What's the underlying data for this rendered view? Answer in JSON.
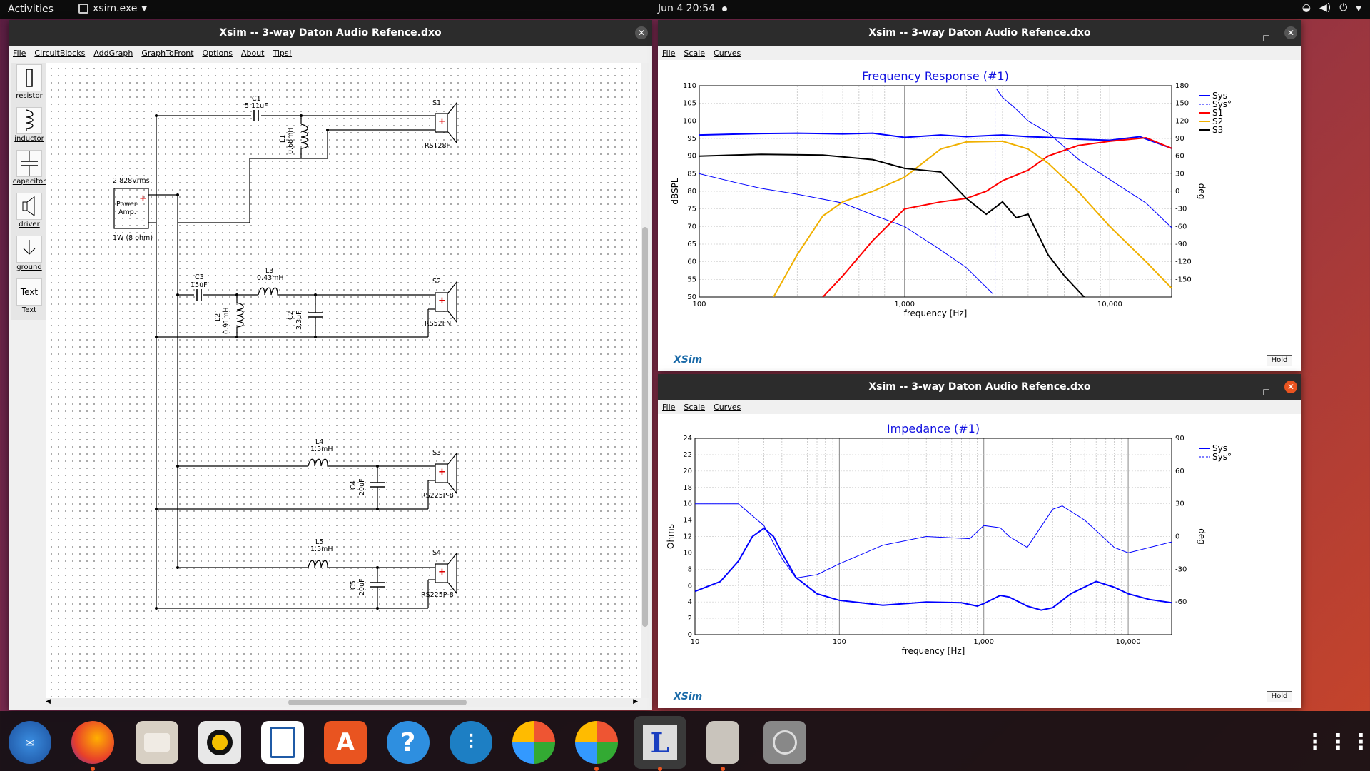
{
  "topbar": {
    "activities": "Activities",
    "app_name": "xsim.exe",
    "clock": "Jun 4  20:54"
  },
  "main_window": {
    "title": "Xsim -- 3-way Daton Audio Refence.dxo",
    "menu": [
      "File",
      "CircuitBlocks",
      "AddGraph",
      "GraphToFront",
      "Options",
      "About",
      "Tips!"
    ],
    "palette": [
      "resistor",
      "inductor",
      "capacitor",
      "driver",
      "ground",
      "Text"
    ],
    "text_tool_glyph": "Text"
  },
  "schematic": {
    "source_voltage": "2.828Vrms",
    "source_name_1": "Power",
    "source_name_2": "Amp.",
    "source_load": "1W (8 ohm)",
    "components": {
      "C1": {
        "name": "C1",
        "value": "5.11uF"
      },
      "L1": {
        "name": "L1",
        "value": "0.68mH"
      },
      "S1": {
        "name": "S1",
        "model": "RST28F"
      },
      "C3": {
        "name": "C3",
        "value": "15uF"
      },
      "L3": {
        "name": "L3",
        "value": "0.43mH"
      },
      "L2": {
        "name": "L2",
        "value": "0.91mH"
      },
      "C2": {
        "name": "C2",
        "value": "3.3uF"
      },
      "S2": {
        "name": "S2",
        "model": "RS52FN"
      },
      "L4": {
        "name": "L4",
        "value": "1.5mH"
      },
      "C4": {
        "name": "C4",
        "value": "20uF"
      },
      "S3": {
        "name": "S3",
        "model": "RS225P-8"
      },
      "L5": {
        "name": "L5",
        "value": "1.5mH"
      },
      "C5": {
        "name": "C5",
        "value": "20uF"
      },
      "S4": {
        "name": "S4",
        "model": "RS225P-8"
      }
    }
  },
  "fr_window": {
    "title": "Xsim -- 3-way Daton Audio Refence.dxo",
    "menu": [
      "File",
      "Scale",
      "Curves"
    ],
    "logo": "XSim",
    "hold_label": "Hold"
  },
  "imp_window": {
    "title": "Xsim -- 3-way Daton Audio Refence.dxo",
    "menu": [
      "File",
      "Scale",
      "Curves"
    ],
    "logo": "XSim",
    "hold_label": "Hold"
  },
  "chart_data": [
    {
      "type": "line",
      "title": "Frequency Response (#1)",
      "xlabel": "frequency [Hz]",
      "ylabel": "dBSPL",
      "y2label": "deg",
      "xscale": "log",
      "xlim": [
        100,
        20000
      ],
      "ylim": [
        50,
        110
      ],
      "y2lim": [
        -180,
        180
      ],
      "xticks": [
        100,
        1000,
        10000
      ],
      "xtick_labels": [
        "100",
        "1,000",
        "10,000"
      ],
      "yticks": [
        50,
        55,
        60,
        65,
        70,
        75,
        80,
        85,
        90,
        95,
        100,
        105,
        110
      ],
      "y2ticks": [
        -150,
        -120,
        -90,
        -60,
        -30,
        0,
        30,
        60,
        90,
        120,
        150,
        180
      ],
      "grid": true,
      "legend_position": "right",
      "series": [
        {
          "name": "Sys",
          "axis": "left",
          "color": "#0000ff",
          "style": "solid",
          "width": 2,
          "x": [
            100,
            200,
            300,
            500,
            700,
            1000,
            1500,
            2000,
            3000,
            4000,
            5000,
            7000,
            10000,
            14000,
            20000
          ],
          "y": [
            96,
            96.4,
            96.5,
            96.3,
            96.5,
            95.3,
            96,
            95.5,
            96,
            95.5,
            95.3,
            94.8,
            94.5,
            95.5,
            92.2
          ]
        },
        {
          "name": "Sys°",
          "axis": "right",
          "color": "#0000ff",
          "style": "dashed",
          "width": 1,
          "x": [
            100,
            150,
            200,
            300,
            500,
            700,
            1000,
            1500,
            2000,
            2700,
            2800,
            3000,
            3500,
            4000,
            5000,
            7000,
            10000,
            15000,
            20000
          ],
          "y": [
            30,
            15,
            5,
            -5,
            -20,
            -40,
            -60,
            -100,
            -130,
            -175,
            175,
            160,
            140,
            120,
            100,
            55,
            20,
            -20,
            -62
          ]
        },
        {
          "name": "S1",
          "axis": "left",
          "color": "#ff0000",
          "style": "solid",
          "width": 2,
          "x": [
            400,
            500,
            700,
            1000,
            1500,
            2000,
            2500,
            3000,
            4000,
            5000,
            7000,
            10000,
            15000,
            20000
          ],
          "y": [
            50,
            56,
            66,
            75,
            77,
            78,
            80,
            83,
            86,
            90,
            93,
            94.2,
            95.2,
            92.2
          ]
        },
        {
          "name": "S2",
          "axis": "left",
          "color": "#f0b000",
          "style": "solid",
          "width": 2,
          "x": [
            230,
            300,
            400,
            500,
            700,
            1000,
            1500,
            2000,
            3000,
            4000,
            5000,
            7000,
            10000,
            15000,
            20000
          ],
          "y": [
            50,
            62,
            73,
            77,
            80,
            84,
            92,
            94,
            94.2,
            92,
            88,
            80,
            70,
            60,
            52.5
          ]
        },
        {
          "name": "S3",
          "axis": "left",
          "color": "#000000",
          "style": "solid",
          "width": 2,
          "x": [
            100,
            200,
            400,
            700,
            1000,
            1500,
            2000,
            2500,
            3000,
            3500,
            4000,
            5000,
            6000,
            7500
          ],
          "y": [
            90,
            90.5,
            90.3,
            89,
            86.5,
            85.5,
            78,
            73.5,
            77,
            72.5,
            73.5,
            62,
            56,
            50
          ]
        }
      ]
    },
    {
      "type": "line",
      "title": "Impedance (#1)",
      "xlabel": "frequency [Hz]",
      "ylabel": "Ohms",
      "y2label": "deg",
      "xscale": "log",
      "xlim": [
        10,
        20000
      ],
      "ylim": [
        0,
        24
      ],
      "y2lim": [
        -90,
        90
      ],
      "xticks": [
        10,
        100,
        1000,
        10000
      ],
      "xtick_labels": [
        "10",
        "100",
        "1,000",
        "10,000"
      ],
      "yticks": [
        0,
        2,
        4,
        6,
        8,
        10,
        12,
        14,
        16,
        18,
        20,
        22,
        24
      ],
      "y2ticks": [
        -60,
        -30,
        0,
        30,
        60,
        90
      ],
      "grid": true,
      "legend_position": "right",
      "series": [
        {
          "name": "Sys",
          "axis": "left",
          "color": "#0000ff",
          "style": "solid",
          "width": 2,
          "x": [
            10,
            15,
            20,
            25,
            30,
            35,
            40,
            50,
            70,
            100,
            200,
            400,
            700,
            900,
            1000,
            1300,
            1500,
            2000,
            2500,
            3000,
            4000,
            6000,
            8000,
            10000,
            14000,
            20000
          ],
          "y": [
            5.3,
            6.5,
            9,
            12,
            13,
            12,
            10,
            7,
            5,
            4.2,
            3.6,
            4,
            3.9,
            3.5,
            3.8,
            4.8,
            4.6,
            3.5,
            3,
            3.3,
            5,
            6.5,
            5.8,
            5,
            4.3,
            3.9
          ]
        },
        {
          "name": "Sys°",
          "axis": "right",
          "color": "#0000ff",
          "style": "dashed",
          "width": 1,
          "x": [
            10,
            20,
            30,
            40,
            50,
            70,
            100,
            200,
            400,
            800,
            1000,
            1300,
            1500,
            2000,
            3000,
            3500,
            5000,
            8000,
            10000,
            20000
          ],
          "y": [
            30,
            30,
            10,
            -20,
            -38,
            -35,
            -25,
            -8,
            0,
            -2,
            10,
            8,
            0,
            -10,
            25,
            28,
            15,
            -10,
            -15,
            -5
          ]
        }
      ]
    }
  ],
  "dock": [
    "thunderbird-icon",
    "firefox-icon",
    "files-icon",
    "rhythmbox-icon",
    "writer-icon",
    "software-icon",
    "help-icon",
    "settings-icon",
    "pinwheel-icon",
    "pinwheel-icon-2",
    "xsim-icon",
    "archive-icon",
    "disk-icon",
    "app-grid-icon"
  ]
}
